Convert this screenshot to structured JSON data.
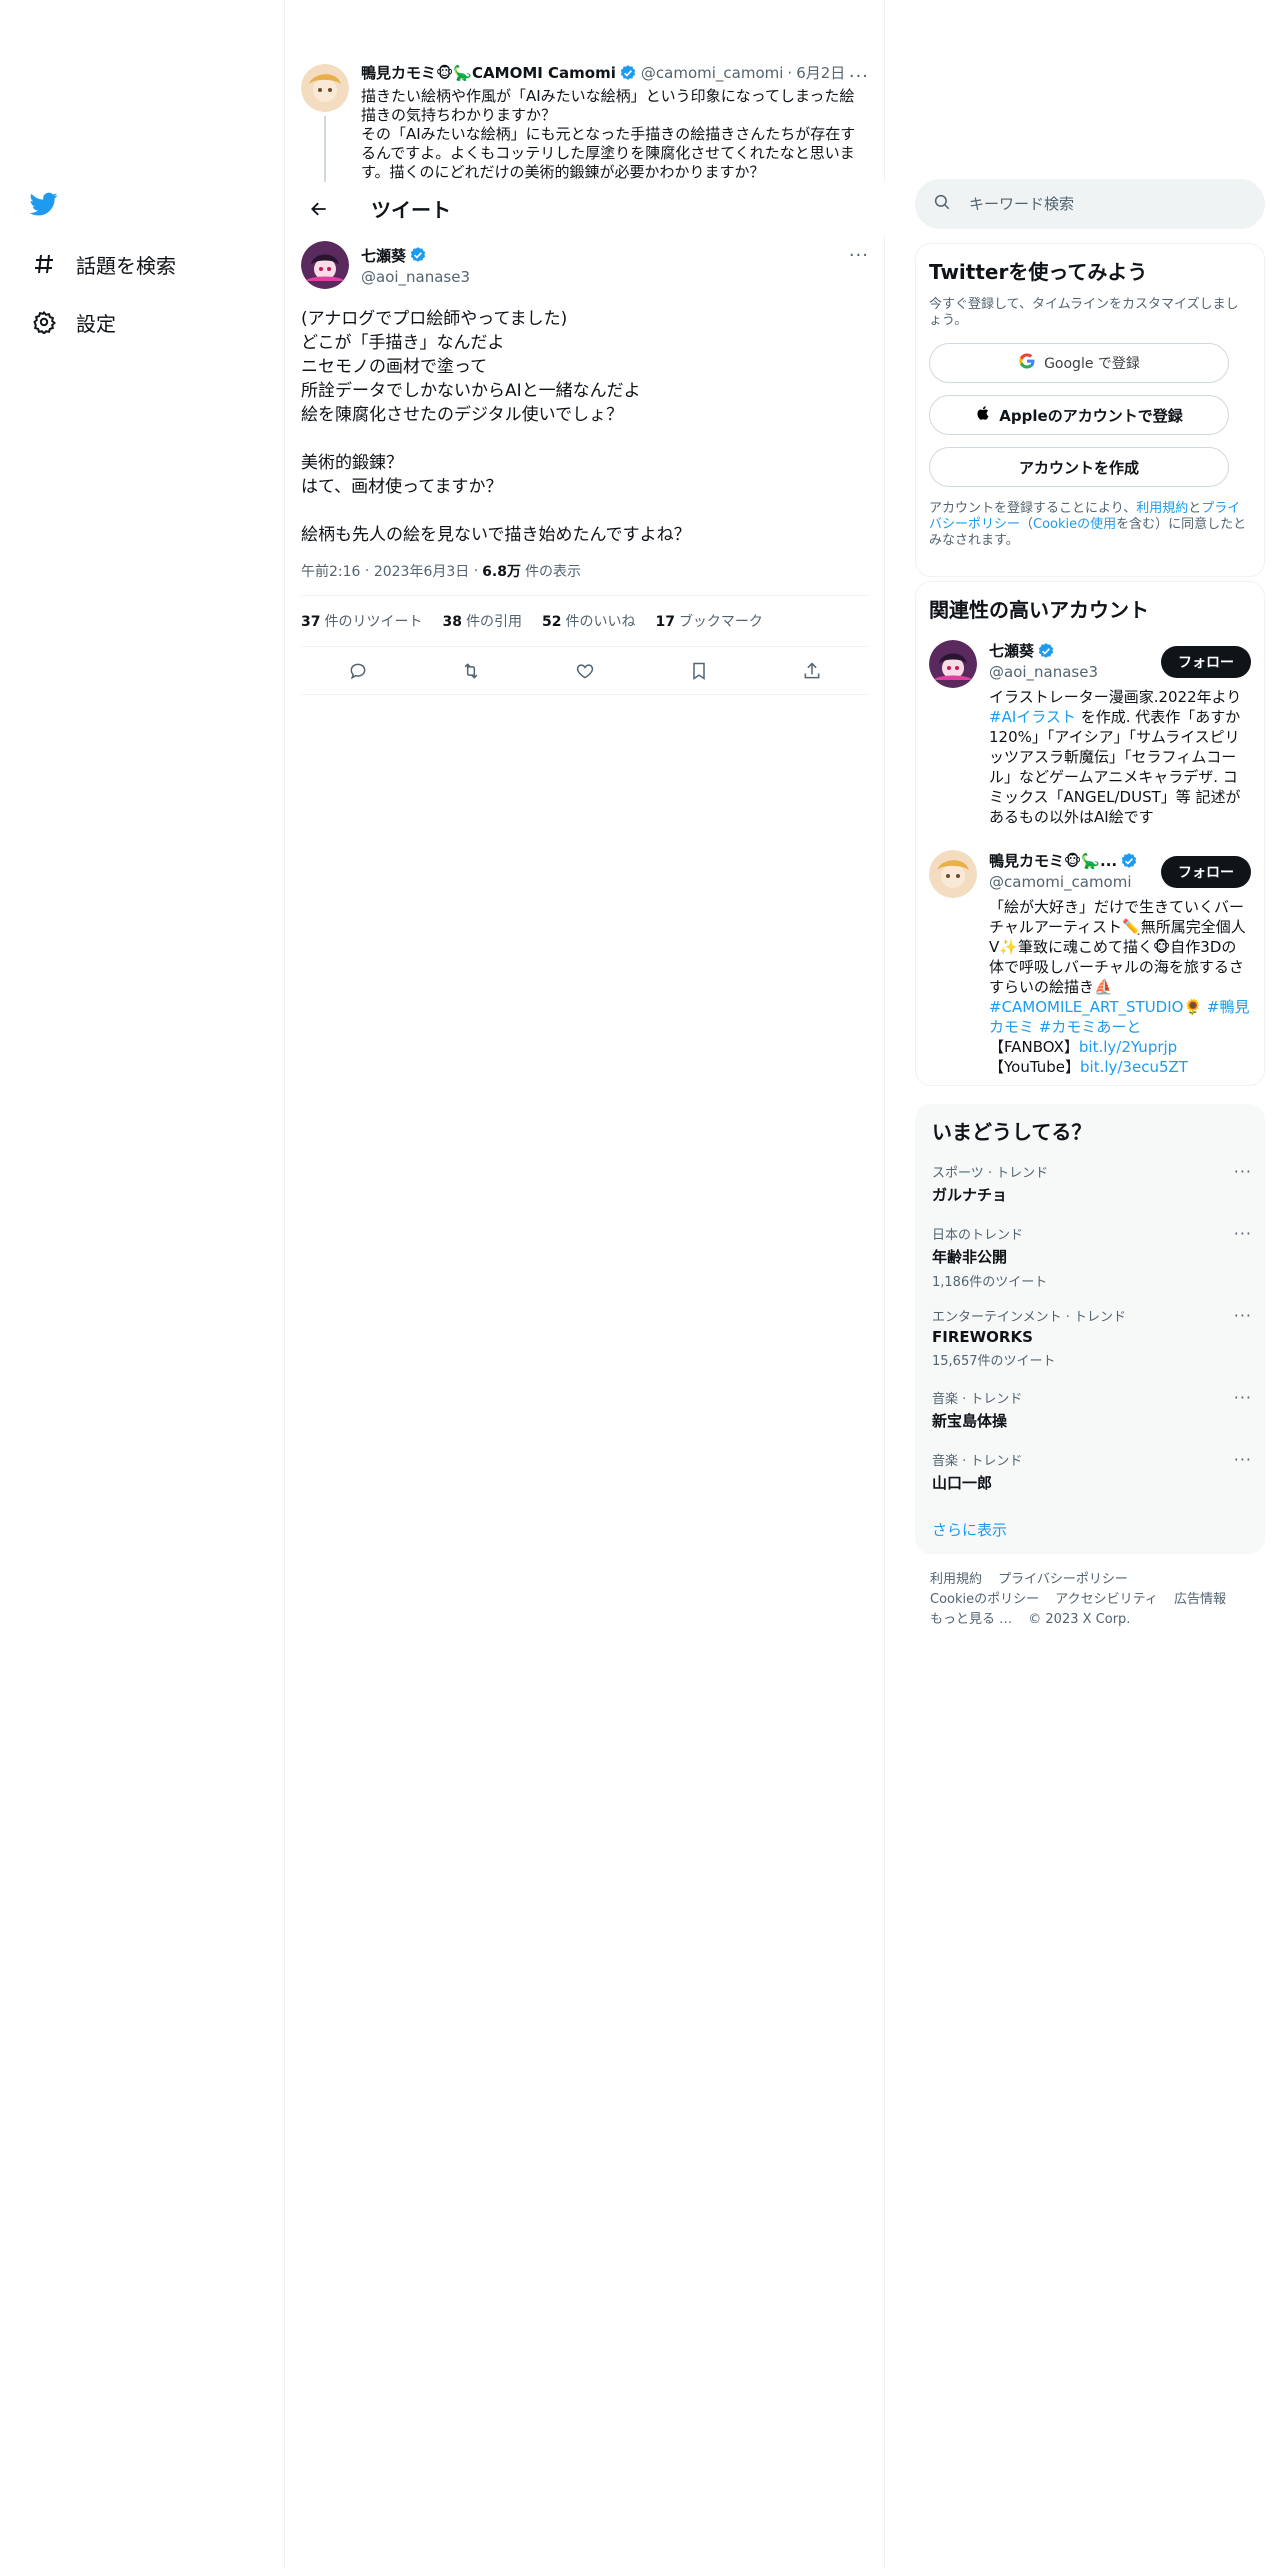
{
  "nav": {
    "items": [
      {
        "label": "話題を検索"
      },
      {
        "label": "設定"
      }
    ]
  },
  "previous_tweet": {
    "name": "鴨見カモミ🐵🦕CAMOMI Camomi",
    "handle": "@camomi_camomi",
    "date": "6月2日",
    "text": "描きたい絵柄や作風が「AIみたいな絵柄」という印象になってしまった絵描きの気持ちわかりますか？\nその「AIみたいな絵柄」にも元となった手描きの絵描きさんたちが存在するんですよ。よくもコッテリした厚塗りを陳腐化させてくれたなと思います。描くのにどれだけの美術的鍛錬が必要かわかりますか？"
  },
  "header": {
    "title": "ツイート"
  },
  "tweet": {
    "name": "七瀬葵",
    "handle": "@aoi_nanase3",
    "lines": [
      "(アナログでプロ絵師やってました)",
      "どこが「手描き」なんだよ",
      "ニセモノの画材で塗って",
      "所詮データでしかないからAIと一緒なんだよ",
      "絵を陳腐化させたのデジタル使いでしょ？",
      "",
      "美術的鍛錬？",
      "はて、画材使ってますか？",
      "",
      "絵柄も先人の絵を見ないで描き始めたんですよね？"
    ],
    "time": "午前2:16",
    "date": "2023年6月3日",
    "views": "6.8万",
    "views_label": "件の表示",
    "stats": [
      {
        "count": "37",
        "label": "件のリツイート"
      },
      {
        "count": "38",
        "label": "件の引用"
      },
      {
        "count": "52",
        "label": "件のいいね"
      },
      {
        "count": "17",
        "label": "ブックマーク"
      }
    ]
  },
  "search": {
    "placeholder": "キーワード検索"
  },
  "signup": {
    "title": "Twitterを使ってみよう",
    "desc": "今すぐ登録して、タイムラインをカスタマイズしましょう。",
    "google_label": "Google で登録",
    "apple_label": "Appleのアカウントで登録",
    "create_label": "アカウントを作成",
    "legal_pre": "アカウントを登録することにより、",
    "legal_terms": "利用規約",
    "legal_and": "と",
    "legal_privacy": "プライバシーポリシー",
    "legal_open": "（",
    "legal_cookie": "Cookieの使用",
    "legal_post": "を含む）に同意したとみなされます。"
  },
  "related": {
    "title": "関連性の高いアカウント",
    "follow_label": "フォロー",
    "accounts": [
      {
        "name": "七瀬葵",
        "handle": "@aoi_nanase3",
        "bio_pre": "イラストレーター漫画家.2022年より",
        "bio_link": "#AIイラスト",
        "bio_post": " を作成. 代表作「あすか120%」「アイシア」「サムライスピリッツアスラ斬魔伝」「セラフィムコール」などゲームアニメキャラデザ. コミックス「ANGEL/DUST」等 記述があるもの以外はAI絵です"
      },
      {
        "name": "鴨見カモミ🐵🦕...",
        "handle": "@camomi_camomi",
        "bio_pre": "「絵が大好き」だけで生きていくバーチャルアーティスト✏️無所属完全個人V✨筆致に魂こめて描く🐵自作3Dの体で呼吸しバーチャルの海を旅するさすらいの絵描き⛵",
        "bio_tags": "#CAMOMILE_ART_STUDIO🌻 #鴨見カモミ #カモミあーと",
        "fanbox_label": "【FANBOX】",
        "fanbox_link": "bit.ly/2Yuprjp",
        "youtube_label": "【YouTube】",
        "youtube_link": "bit.ly/3ecu5ZT"
      }
    ]
  },
  "trends": {
    "title": "いまどうしてる？",
    "items": [
      {
        "category": "スポーツ · トレンド",
        "name": "ガルナチョ",
        "count": ""
      },
      {
        "category": "日本のトレンド",
        "name": "年齢非公開",
        "count": "1,186件のツイート"
      },
      {
        "category": "エンターテインメント · トレンド",
        "name": "FIREWORKS",
        "count": "15,657件のツイート"
      },
      {
        "category": "音楽 · トレンド",
        "name": "新宝島体操",
        "count": ""
      },
      {
        "category": "音楽 · トレンド",
        "name": "山口一郎",
        "count": ""
      }
    ],
    "show_more": "さらに表示"
  },
  "footer": {
    "links": [
      "利用規約",
      "プライバシーポリシー",
      "Cookieのポリシー",
      "アクセシビリティ",
      "広告情報",
      "もっと見る …"
    ],
    "copyright": "© 2023 X Corp."
  },
  "colors": {
    "accent": "#1d9bf0",
    "text": "#0f1419",
    "muted": "#536471"
  }
}
